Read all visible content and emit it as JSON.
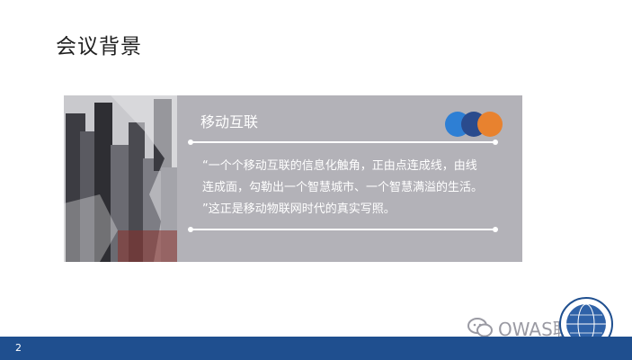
{
  "slide": {
    "title": "会议背景",
    "page_number": "2"
  },
  "card": {
    "heading": "移动互联",
    "quote_lines": [
      "“一个个移动互联的信息化触角，正由点连成线，由线",
      "连成面，勾勒出一个智慧城市、一个智慧满溢的生活。",
      "”这正是移动物联网时代的真实写照。"
    ],
    "dot_colors": [
      "#2e7fd4",
      "#2a4b8d",
      "#e8822f"
    ]
  },
  "watermark": {
    "text": "OWAS联盟",
    "icon": "wechat-icon"
  },
  "colors": {
    "footer": "#1f4f8f",
    "card": "#b3b2b8"
  }
}
